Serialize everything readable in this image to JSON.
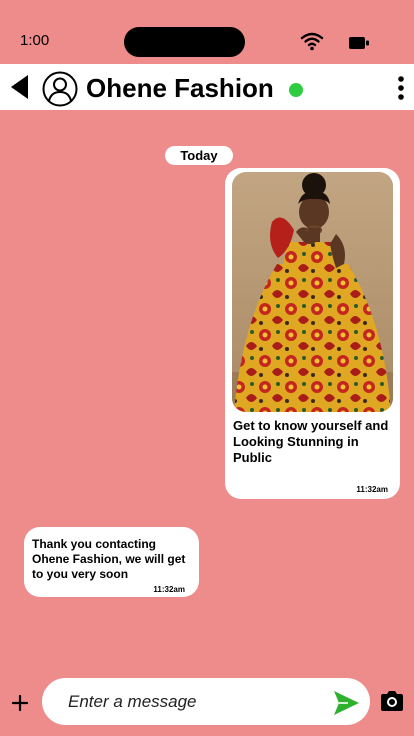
{
  "status_bar": {
    "time": "1:00",
    "wifi_icon": "wifi-icon",
    "battery_icon": "battery-icon"
  },
  "header": {
    "back_icon": "back-arrow-icon",
    "avatar_icon": "user-avatar-icon",
    "contact_name": "Ohene Fashion",
    "online_status_color": "#2ecc40",
    "menu_icon": "more-vertical-icon"
  },
  "chat": {
    "date_label": "Today",
    "messages": [
      {
        "direction": "outgoing",
        "image_description": "girl in red and yellow ankara print gown",
        "text": "Get to know yourself and Looking  Stunning in Public",
        "time": "11:32am"
      },
      {
        "direction": "incoming",
        "text": "Thank you contacting Ohene Fashion, we will get to you very soon",
        "time": "11:32am"
      }
    ]
  },
  "composer": {
    "plus_icon": "plus-icon",
    "placeholder": "Enter a message",
    "send_icon": "send-icon",
    "send_color": "#2fb12f",
    "camera_icon": "camera-icon"
  },
  "colors": {
    "background": "#ee8b8b",
    "bubble": "#ffffff",
    "online": "#2ecc40"
  }
}
